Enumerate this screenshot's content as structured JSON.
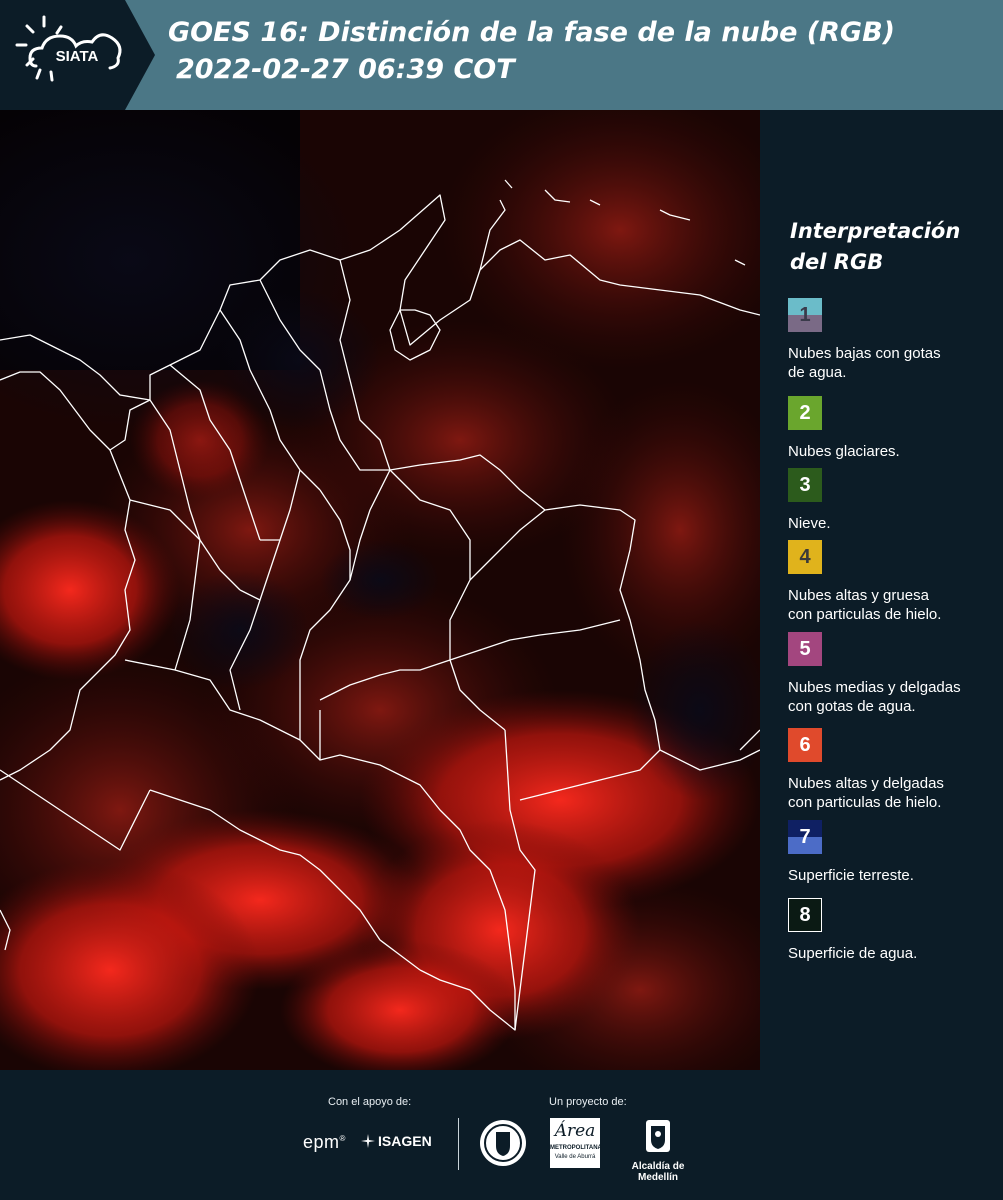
{
  "header": {
    "logo_text": "SIATA",
    "title_line1": "GOES 16: Distinción de la fase de la nube (RGB)",
    "title_line2": "2022-02-27 06:39 COT"
  },
  "legend": {
    "title_line1": "Interpretación",
    "title_line2": "del RGB",
    "items": [
      {
        "number": "1",
        "label_lines": [
          "Nubes bajas con gotas",
          "de agua."
        ],
        "top_color": "#6bbcc9",
        "bottom_color": "#7a6a86",
        "text_color": "#3a3a4a"
      },
      {
        "number": "2",
        "label_lines": [
          "Nubes glaciares."
        ],
        "top_color": "#6aa62d",
        "bottom_color": "#6aa62d",
        "text_color": "#ffffff"
      },
      {
        "number": "3",
        "label_lines": [
          "Nieve."
        ],
        "top_color": "#2c5b1c",
        "bottom_color": "#2c5b1c",
        "text_color": "#ffffff"
      },
      {
        "number": "4",
        "label_lines": [
          "Nubes altas y gruesa",
          "con particulas de hielo."
        ],
        "top_color": "#e0b31c",
        "bottom_color": "#e0b31c",
        "text_color": "#3a3a3a"
      },
      {
        "number": "5",
        "label_lines": [
          "Nubes medias y delgadas",
          "con gotas de agua."
        ],
        "top_color": "#a3467f",
        "bottom_color": "#a3467f",
        "text_color": "#ffffff"
      },
      {
        "number": "6",
        "label_lines": [
          "Nubes altas y delgadas",
          "con particulas de hielo."
        ],
        "top_color": "#e04a2c",
        "bottom_color": "#e04a2c",
        "text_color": "#ffffff"
      },
      {
        "number": "7",
        "label_lines": [
          "Superficie terreste."
        ],
        "top_color": "#0f2063",
        "bottom_color": "#4c6cc7",
        "text_color": "#ffffff"
      },
      {
        "number": "8",
        "label_lines": [
          "Superficie de agua."
        ],
        "top_color": "#0b1a14",
        "bottom_color": "#0b1a14",
        "text_color": "#ffffff",
        "border": "#ffffff"
      }
    ]
  },
  "footer": {
    "support_label": "Con el apoyo de:",
    "project_label": "Un proyecto de:",
    "partners": [
      "epm",
      "ISAGEN"
    ],
    "area_lines": [
      "Área",
      "METROPOLITANA",
      "Valle de Aburrá"
    ],
    "alcaldia": "Alcaldía de Medellín"
  }
}
